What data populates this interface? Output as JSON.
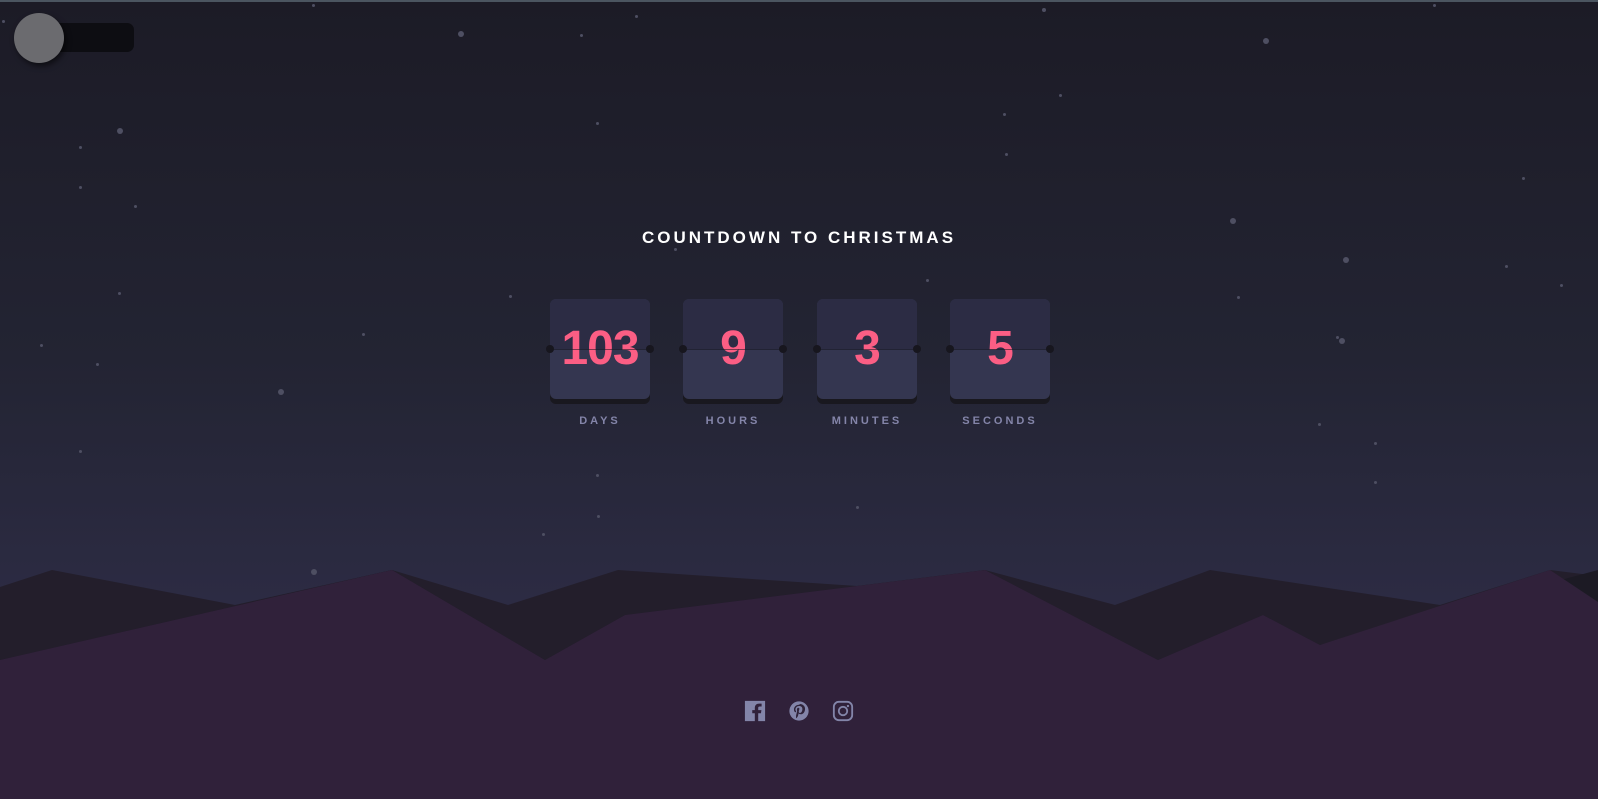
{
  "page": {
    "title": "COUNTDOWN TO CHRISTMAS"
  },
  "theme_toggle": {
    "state": "dark",
    "icon": "theme-toggle-knob"
  },
  "countdown": [
    {
      "value": "103",
      "label": "DAYS"
    },
    {
      "value": "9",
      "label": "HOURS"
    },
    {
      "value": "3",
      "label": "MINUTES"
    },
    {
      "value": "5",
      "label": "SECONDS"
    }
  ],
  "social": [
    {
      "name": "facebook",
      "icon": "facebook-icon"
    },
    {
      "name": "pinterest",
      "icon": "pinterest-icon"
    },
    {
      "name": "instagram",
      "icon": "instagram-icon"
    }
  ],
  "colors": {
    "accent": "#fb5e84",
    "card": "#343650",
    "label": "#8485a9",
    "hills_front": "#30213a",
    "hills_back": "#231e2b"
  }
}
